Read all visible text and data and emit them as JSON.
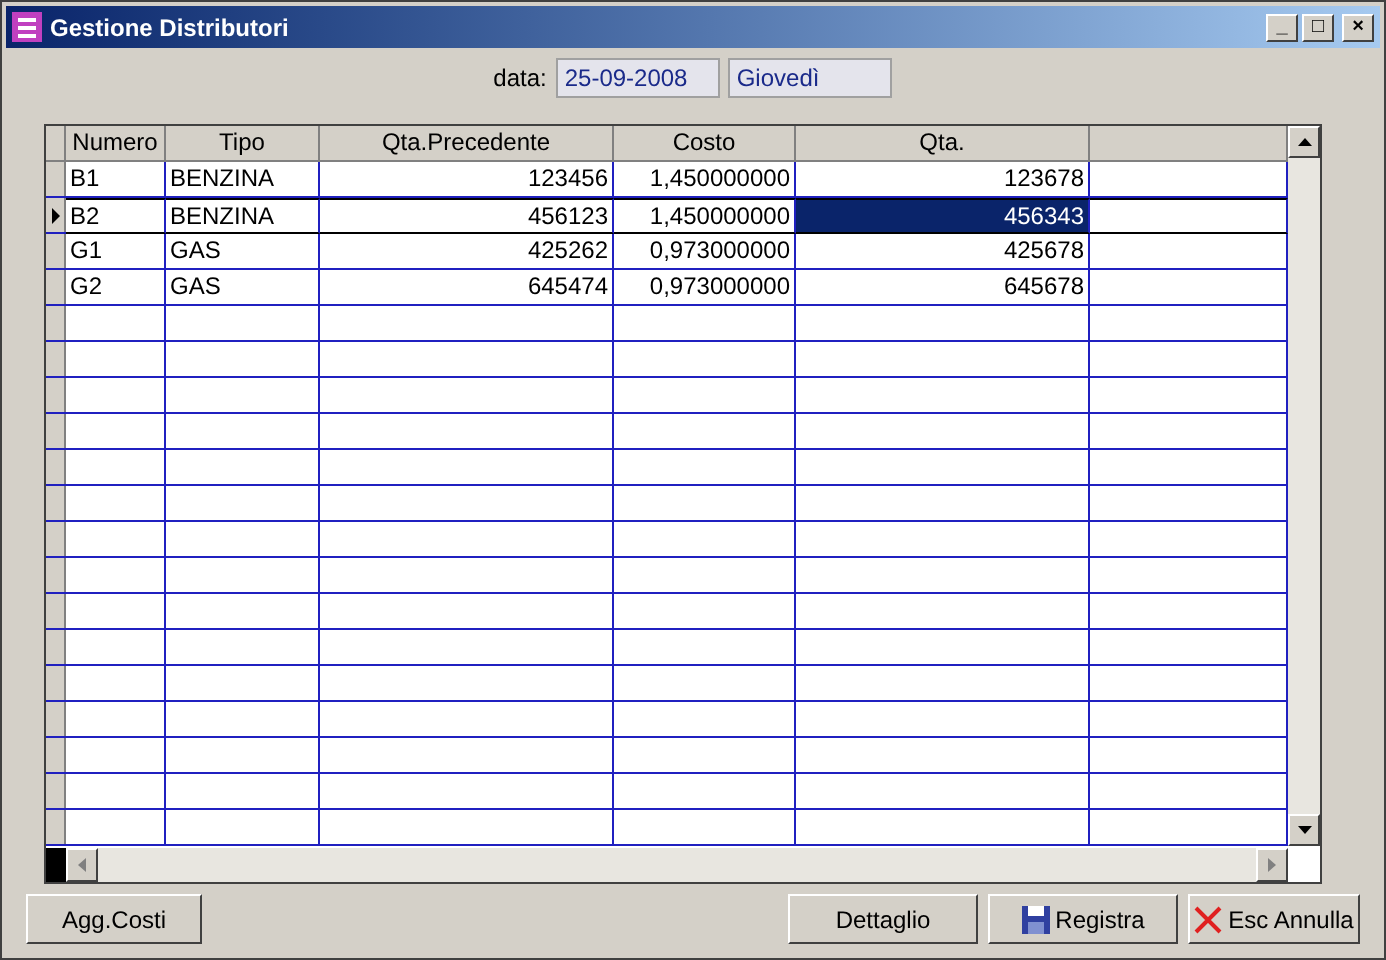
{
  "window": {
    "title": "Gestione Distributori",
    "controls": [
      "_",
      "□",
      "×"
    ]
  },
  "date": {
    "label": "data:",
    "value": "25-09-2008",
    "weekday": "Giovedì"
  },
  "table": {
    "columns": [
      {
        "label": "Numero"
      },
      {
        "label": "Tipo"
      },
      {
        "label": "Qta.Precedente"
      },
      {
        "label": "Costo"
      },
      {
        "label": "Qta."
      }
    ],
    "rows": [
      {
        "selected": false,
        "cells": [
          "B1",
          "BENZINA",
          "123456",
          "1,450000000",
          "123678"
        ]
      },
      {
        "selected": true,
        "cells": [
          "B2",
          "BENZINA",
          "456123",
          "1,450000000",
          "456343"
        ]
      },
      {
        "selected": false,
        "cells": [
          "G1",
          "GAS",
          "425262",
          "0,973000000",
          "425678"
        ]
      },
      {
        "selected": false,
        "cells": [
          "G2",
          "GAS",
          "645474",
          "0,973000000",
          "645678"
        ]
      }
    ]
  },
  "buttons": [
    {
      "label": "Agg.Costi",
      "kind": "plain"
    },
    {
      "label": "Dettaglio",
      "kind": "plain"
    },
    {
      "label": "Registra",
      "kind": "save"
    },
    {
      "label": "Esc Annulla",
      "kind": "cancel"
    }
  ]
}
